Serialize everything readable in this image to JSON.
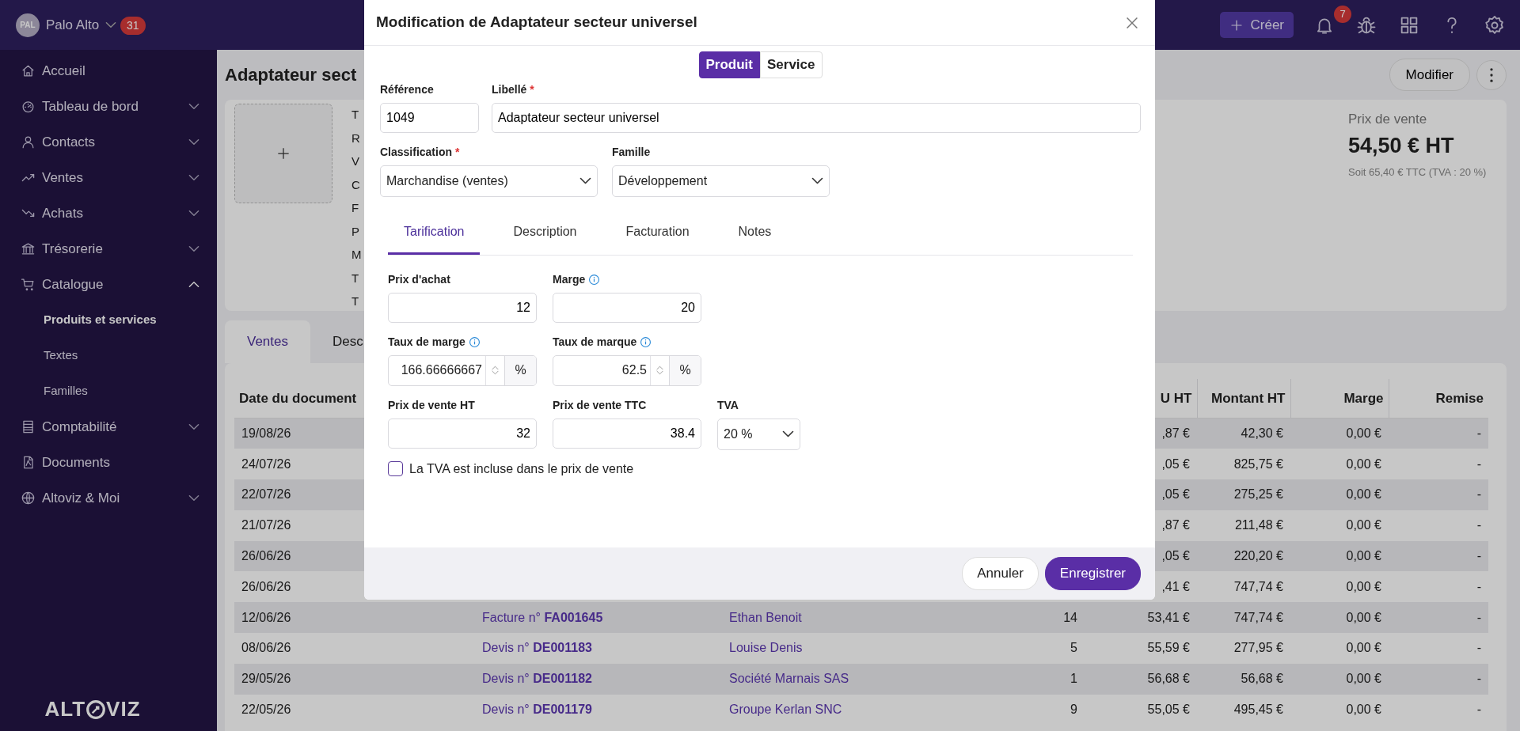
{
  "top_bar": {
    "avatar": "PAL",
    "company": "Palo Alto",
    "company_badge": "31",
    "create_button": "Créer",
    "notification_badge": "7"
  },
  "sidebar": {
    "items": [
      {
        "label": "Accueil"
      },
      {
        "label": "Tableau de bord",
        "expanded": false
      },
      {
        "label": "Contacts",
        "expanded": false
      },
      {
        "label": "Ventes",
        "expanded": false
      },
      {
        "label": "Achats",
        "expanded": false
      },
      {
        "label": "Trésorerie",
        "expanded": false
      },
      {
        "label": "Catalogue",
        "expanded": true,
        "children": [
          {
            "label": "Produits et services",
            "selected": true
          },
          {
            "label": "Textes",
            "selected": false
          },
          {
            "label": "Familles",
            "selected": false
          }
        ]
      },
      {
        "label": "Comptabilité",
        "expanded": false
      },
      {
        "label": "Documents"
      },
      {
        "label": "Altoviz & Moi",
        "expanded": false
      }
    ],
    "logo": {
      "left": "ALT",
      "right": "VIZ"
    }
  },
  "page": {
    "title": "Adaptateur sect",
    "edit_button": "Modifier",
    "info_labels": [
      "T",
      "R",
      "V",
      "C",
      "F",
      "P",
      "M",
      "T",
      "T"
    ],
    "price": {
      "label": "Prix de vente",
      "value": "54,50 € HT",
      "note": "Soit 65,40 € TTC (TVA : 20 %)"
    },
    "tabs": [
      {
        "label": "Ventes",
        "selected": true
      },
      {
        "label": "Desc",
        "selected": false
      }
    ],
    "table": {
      "columns": {
        "date": "Date du document",
        "unit_price": "U HT",
        "amount": "Montant HT",
        "margin": "Marge",
        "discount": "Remise"
      },
      "rows": [
        {
          "date": "19/08/26",
          "unit_price": ",87 €",
          "amount": "42,30 €",
          "margin": "0,00 €",
          "discount": "-"
        },
        {
          "date": "24/07/26",
          "unit_price": ",05 €",
          "amount": "825,75 €",
          "margin": "0,00 €",
          "discount": "-"
        },
        {
          "date": "22/07/26",
          "unit_price": ",05 €",
          "amount": "275,25 €",
          "margin": "0,00 €",
          "discount": "-"
        },
        {
          "date": "21/07/26",
          "unit_price": ",87 €",
          "amount": "211,48 €",
          "margin": "0,00 €",
          "discount": "-"
        },
        {
          "date": "26/06/26",
          "unit_price": ",05 €",
          "amount": "220,20 €",
          "margin": "0,00 €",
          "discount": "-"
        },
        {
          "date": "26/06/26",
          "unit_price": ",41 €",
          "amount": "747,74 €",
          "margin": "0,00 €",
          "discount": "-"
        },
        {
          "date": "12/06/26",
          "document": "Facture n° **FA001645**",
          "client": "Ethan Benoit",
          "quantity": "14",
          "unit_price": "53,41 €",
          "amount": "747,74 €",
          "margin": "0,00 €",
          "discount": "-"
        },
        {
          "date": "08/06/26",
          "document": "Devis n° **DE001183**",
          "client": "Louise Denis",
          "quantity": "5",
          "unit_price": "55,59 €",
          "amount": "277,95 €",
          "margin": "0,00 €",
          "discount": "-"
        },
        {
          "date": "29/05/26",
          "document": "Devis n° **DE001182**",
          "client": "Société Marnais SAS",
          "quantity": "1",
          "unit_price": "56,68 €",
          "amount": "56,68 €",
          "margin": "0,00 €",
          "discount": "-"
        },
        {
          "date": "22/05/26",
          "document": "Devis n° **DE001179**",
          "client": "Groupe Kerlan SNC",
          "quantity": "9",
          "unit_price": "55,05 €",
          "amount": "495,45 €",
          "margin": "0,00 €",
          "discount": "-"
        }
      ]
    }
  },
  "modal": {
    "title": "Modification de Adaptateur secteur universel",
    "type_toggle": [
      {
        "label": "Produit",
        "selected": true
      },
      {
        "label": "Service",
        "selected": false
      }
    ],
    "fields": [
      {
        "label": "Référence",
        "value": "1049"
      },
      {
        "label": "Libellé",
        "required_mark": "*",
        "value": "Adaptateur secteur universel"
      }
    ],
    "selects": [
      {
        "label": "Classification",
        "required_mark": "*",
        "value": "Marchandise (ventes)"
      },
      {
        "label": "Famille",
        "value": "Développement"
      }
    ],
    "tabs": [
      {
        "label": "Tarification",
        "selected": true
      },
      {
        "label": "Description",
        "selected": false
      },
      {
        "label": "Facturation",
        "selected": false
      },
      {
        "label": "Notes",
        "selected": false
      }
    ],
    "pricing_rows": [
      [
        {
          "kind": "input",
          "label": "Prix d'achat",
          "info": false,
          "value": "12"
        },
        {
          "kind": "input",
          "label": "Marge",
          "info": true,
          "value": "20"
        }
      ],
      [
        {
          "kind": "spin",
          "label": "Taux de marge",
          "info": true,
          "value": "166.66666667",
          "unit": "%"
        },
        {
          "kind": "spin",
          "label": "Taux de marque",
          "info": true,
          "value": "62.5",
          "unit": "%"
        }
      ],
      [
        {
          "kind": "input",
          "label": "Prix de vente HT",
          "info": false,
          "value": "32"
        },
        {
          "kind": "input",
          "label": "Prix de vente TTC",
          "info": false,
          "value": "38.4"
        },
        {
          "kind": "select",
          "label": "TVA",
          "info": false,
          "value": "20 %"
        }
      ]
    ],
    "vat_checkbox": {
      "label": "La TVA est incluse dans le prix de vente",
      "checked": false
    },
    "footer_buttons": [
      {
        "label": "Annuler",
        "kind": "secondary"
      },
      {
        "label": "Enregistrer",
        "kind": "primary"
      }
    ]
  }
}
